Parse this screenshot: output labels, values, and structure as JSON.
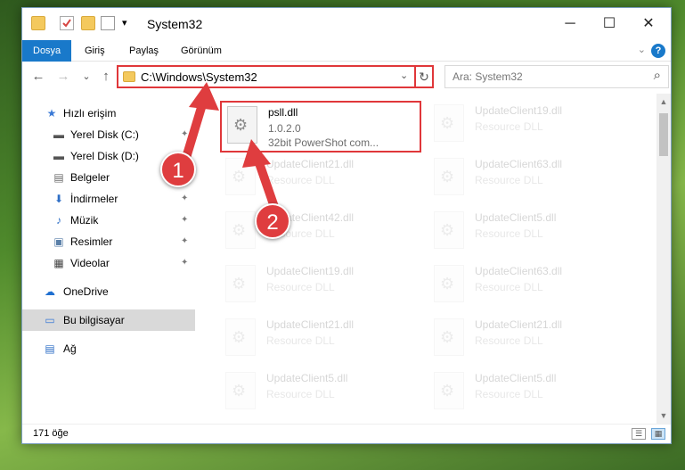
{
  "window": {
    "title": "System32",
    "minimize_glyph": "─",
    "maximize_glyph": "☐",
    "close_glyph": "✕"
  },
  "quick_access_toolbar": {
    "dropdown_glyph": "▾"
  },
  "ribbon": {
    "tabs": [
      {
        "label": "Dosya",
        "active": true
      },
      {
        "label": "Giriş"
      },
      {
        "label": "Paylaş"
      },
      {
        "label": "Görünüm"
      }
    ],
    "expand_glyph": "⌄",
    "help_glyph": "?"
  },
  "nav": {
    "back_glyph": "←",
    "forward_glyph": "→",
    "recent_glyph": "⌄",
    "up_glyph": "↑",
    "address_path": "C:\\Windows\\System32",
    "address_dropdown_glyph": "⌄",
    "refresh_glyph": "↻",
    "search_placeholder": "Ara: System32",
    "search_glyph": "⌕"
  },
  "sidebar": {
    "items": [
      {
        "label": "Hızlı erişim",
        "icon": "star-icon",
        "glyph": "★",
        "color": "#3b7ad6"
      },
      {
        "label": "Yerel Disk (C:)",
        "icon": "drive-icon",
        "glyph": "▬",
        "color": "#555555",
        "pin": "✦"
      },
      {
        "label": "Yerel Disk (D:)",
        "icon": "drive-icon",
        "glyph": "▬",
        "color": "#555555",
        "pin": "✦"
      },
      {
        "label": "Belgeler",
        "icon": "documents-icon",
        "glyph": "▤",
        "color": "#6d6d6d",
        "pin": "✦"
      },
      {
        "label": "İndirmeler",
        "icon": "download-icon",
        "glyph": "⬇",
        "color": "#2f6fc6",
        "pin": "✦"
      },
      {
        "label": "Müzik",
        "icon": "music-icon",
        "glyph": "♪",
        "color": "#2f6fc6",
        "pin": "✦"
      },
      {
        "label": "Resimler",
        "icon": "pictures-icon",
        "glyph": "▣",
        "color": "#5a7fa8",
        "pin": "✦"
      },
      {
        "label": "Videolar",
        "icon": "video-icon",
        "glyph": "▦",
        "color": "#444444",
        "pin": "✦"
      },
      {
        "label": "OneDrive",
        "icon": "cloud-icon",
        "glyph": "☁",
        "color": "#1f6fd0"
      },
      {
        "label": "Bu bilgisayar",
        "icon": "computer-icon",
        "glyph": "▭",
        "color": "#3b7ad6",
        "selected": true
      },
      {
        "label": "Ağ",
        "icon": "network-icon",
        "glyph": "▤",
        "color": "#2f6fc6"
      }
    ]
  },
  "files": {
    "highlighted": {
      "name": "psll.dll",
      "version": "1.0.2.0",
      "description": "32bit PowerShot com..."
    },
    "faded": [
      {
        "name": "UpdateClient19.dll",
        "type": "Resource DLL"
      },
      {
        "name": "UpdateClient21.dll",
        "type": "Resource DLL"
      },
      {
        "name": "UpdateClient63.dll",
        "type": "Resource DLL"
      },
      {
        "name": "UpdateClient42.dll",
        "type": "Resource DLL"
      },
      {
        "name": "UpdateClient5.dll",
        "type": "Resource DLL"
      },
      {
        "name": "UpdateClient19.dll",
        "type": "Resource DLL"
      },
      {
        "name": "UpdateClient63.dll",
        "type": "Resource DLL"
      },
      {
        "name": "UpdateClient21.dll",
        "type": "Resource DLL"
      },
      {
        "name": "UpdateClient21.dll",
        "type": "Resource DLL"
      },
      {
        "name": "UpdateClient5.dll",
        "type": "Resource DLL"
      },
      {
        "name": "UpdateClient5.dll",
        "type": "Resource DLL"
      }
    ]
  },
  "status": {
    "item_count": "171 öğe",
    "details_view_glyph": "☰",
    "icons_view_glyph": "▦"
  },
  "annotations": {
    "step1": "1",
    "step2": "2",
    "color": "#df3d3f"
  }
}
